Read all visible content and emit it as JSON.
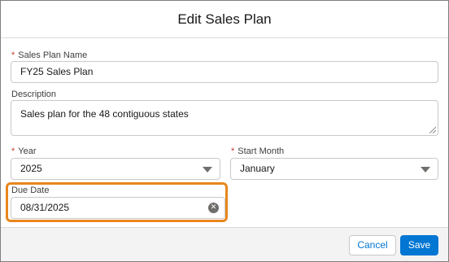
{
  "modal": {
    "title": "Edit Sales Plan"
  },
  "fields": {
    "required_marker": "*",
    "sales_plan_name": {
      "label": "Sales Plan Name",
      "value": "FY25 Sales Plan"
    },
    "description": {
      "label": "Description",
      "value": "Sales plan for the 48 contiguous states"
    },
    "year": {
      "label": "Year",
      "value": "2025"
    },
    "start_month": {
      "label": "Start Month",
      "value": "January"
    },
    "due_date": {
      "label": "Due Date",
      "value": "08/31/2025"
    }
  },
  "footer": {
    "cancel_label": "Cancel",
    "save_label": "Save"
  },
  "colors": {
    "highlight": "#e8861d",
    "brand": "#0176d3",
    "required": "#c23934"
  }
}
